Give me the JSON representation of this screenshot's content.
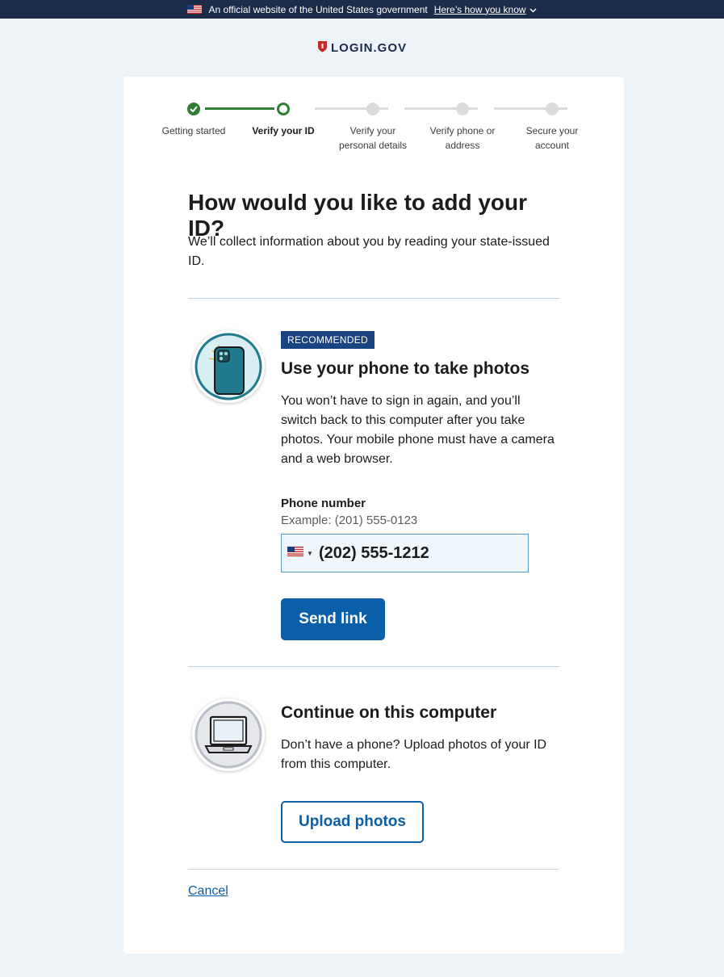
{
  "gov_banner": {
    "text": "An official website of the United States government",
    "link": "Here’s how you know"
  },
  "brand": {
    "name": "LOGIN.GOV"
  },
  "steps": [
    {
      "label": "Getting started",
      "state": "done"
    },
    {
      "label": "Verify your ID",
      "state": "current"
    },
    {
      "label": "Verify your personal details",
      "state": "todo"
    },
    {
      "label": "Verify phone or address",
      "state": "todo"
    },
    {
      "label": "Secure your account",
      "state": "todo"
    }
  ],
  "page": {
    "title": "How would you like to add your ID?",
    "intro": "We’ll collect information about you by reading your state-issued ID."
  },
  "phone_option": {
    "badge": "RECOMMENDED",
    "title": "Use your phone to take photos",
    "description": "You won’t have to sign in again, and you’ll switch back to this computer after you take photos. Your mobile phone must have a camera and a web browser.",
    "field_label": "Phone number",
    "field_hint": "Example: (201) 555-0123",
    "phone_value": "(202) 555-1212",
    "button": "Send link"
  },
  "computer_option": {
    "title": "Continue on this computer",
    "description": "Don’t have a phone? Upload photos of your ID from this computer.",
    "button": "Upload photos"
  },
  "cancel": "Cancel",
  "colors": {
    "primary": "#0b5ea8",
    "success": "#2e7d32",
    "badge": "#1a4480",
    "banner": "#1b2b4a"
  },
  "icons": [
    "us-flag-icon",
    "chevron-down-icon",
    "shield-logo-icon",
    "check-icon",
    "phone-illustration-icon",
    "laptop-illustration-icon"
  ]
}
